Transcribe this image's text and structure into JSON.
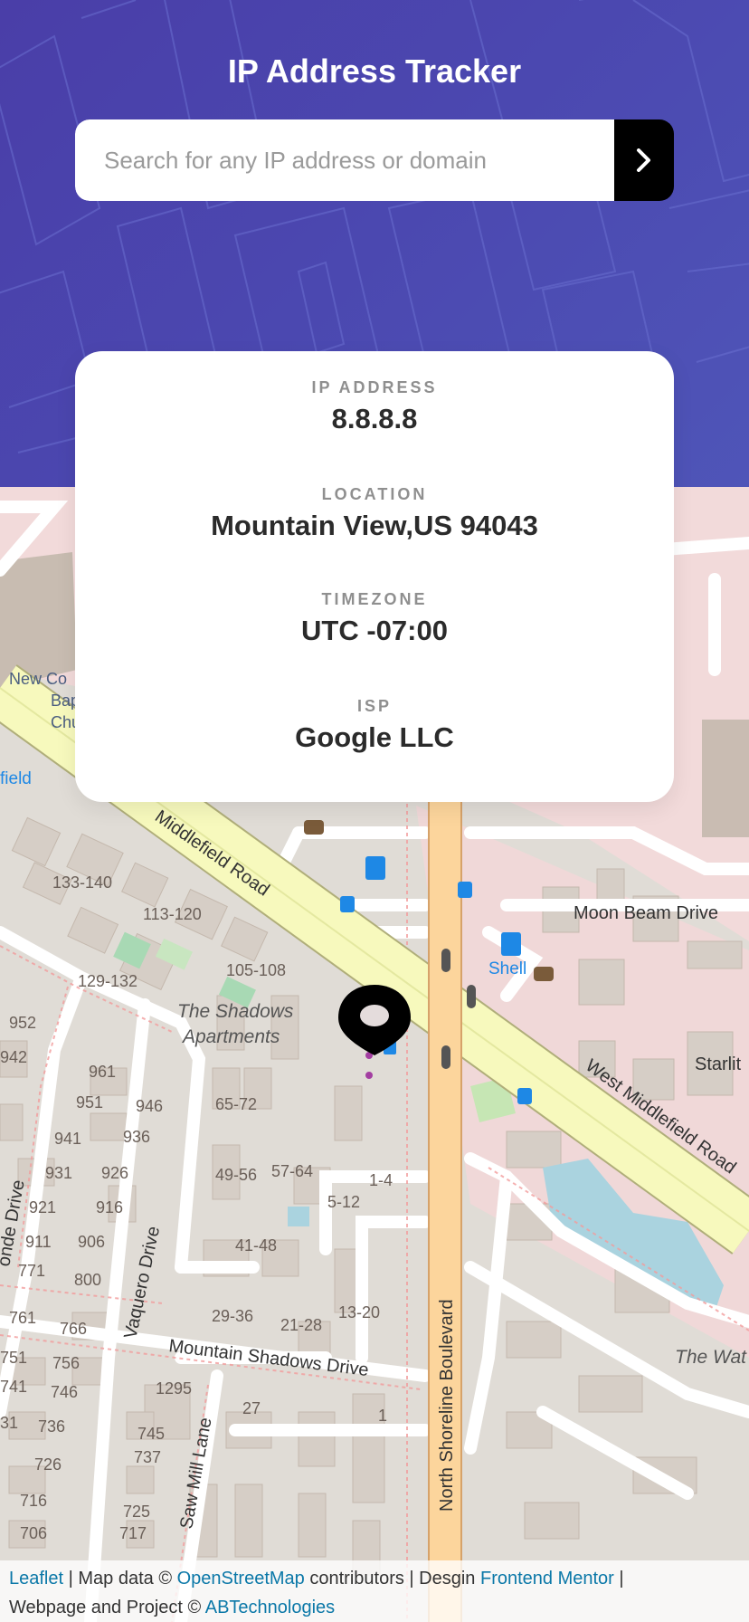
{
  "header": {
    "title": "IP Address Tracker",
    "search_placeholder": "Search for any IP address or domain",
    "submit_icon": "chevron-right-icon"
  },
  "info": {
    "ip_label": "IP ADDRESS",
    "ip_value": "8.8.8.8",
    "location_label": "LOCATION",
    "location_value": "Mountain View,US 94043",
    "timezone_label": "TIMEZONE",
    "timezone_value": "UTC -07:00",
    "isp_label": "ISP",
    "isp_value": "Google LLC"
  },
  "map": {
    "marker_icon": "location-pin-icon",
    "labels": {
      "middlefield_road": "Middlefield Road",
      "west_middlefield_road": "West Middlefield Road",
      "moon_beam_drive": "Moon Beam Drive",
      "north_shoreline": "North Shoreline Boulevard",
      "mountain_shadows_drive": "Mountain Shadows Drive",
      "vaquero_drive": "Vaquero Drive",
      "saw_mill_lane": "Saw Mill Lane",
      "shadows_apartments_1": "The Shadows",
      "shadows_apartments_2": "Apartments",
      "shell": "Shell",
      "starlite": "Starlit",
      "the_wat": "The Wat",
      "new_co": "New Co",
      "bap": "Bap",
      "chu": "Chu",
      "field": "field",
      "onde_drive": "onde Drive",
      "n133_140": "133-140",
      "n113_120": "113-120",
      "n105_108": "105-108",
      "n129_132": "129-132",
      "n952": "952",
      "n942": "942",
      "n961": "961",
      "n951": "951",
      "n946": "946",
      "n941": "941",
      "n936": "936",
      "n931": "931",
      "n926": "926",
      "n921": "921",
      "n916": "916",
      "n911": "911",
      "n906": "906",
      "n771": "771",
      "n800": "800",
      "n761": "761",
      "n766": "766",
      "n751": "751",
      "n756": "756",
      "n741": "741",
      "n746": "746",
      "n31": "31",
      "n736": "736",
      "n726": "726",
      "n716": "716",
      "n706": "706",
      "n1295": "1295",
      "n745": "745",
      "n737": "737",
      "n725": "725",
      "n717": "717",
      "n27": "27",
      "n1": "1",
      "n65_72": "65-72",
      "n49_56": "49-56",
      "n57_64": "57-64",
      "n1_4": "1-4",
      "n5_12": "5-12",
      "n41_48": "41-48",
      "n29_36": "29-36",
      "n21_28": "21-28",
      "n13_20": "13-20"
    }
  },
  "attribution": {
    "leaflet": "Leaflet",
    "sep1": " | Map data © ",
    "osm": "OpenStreetMap",
    "contributors": " contributors | Desgin ",
    "frontend_mentor": "Frontend Mentor",
    "sep2": " | ",
    "webpage": "Webpage and Project © ",
    "ab": "ABTechnologies"
  }
}
